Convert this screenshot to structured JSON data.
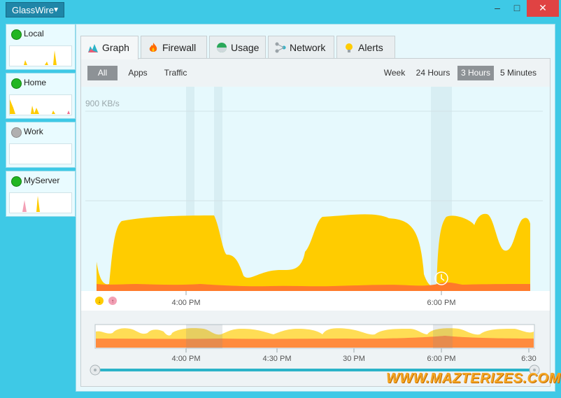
{
  "app": {
    "title": "GlassWire"
  },
  "window_controls": {
    "minimize": "–",
    "maximize": "□",
    "close": "✕"
  },
  "networks": [
    {
      "name": "Local",
      "status": "connected"
    },
    {
      "name": "Home",
      "status": "connected"
    },
    {
      "name": "Work",
      "status": "disconnected"
    },
    {
      "name": "MyServer",
      "status": "connected"
    }
  ],
  "tabs": [
    {
      "label": "Graph",
      "icon": "graph-icon"
    },
    {
      "label": "Firewall",
      "icon": "flame-icon"
    },
    {
      "label": "Usage",
      "icon": "pie-icon"
    },
    {
      "label": "Network",
      "icon": "network-icon"
    },
    {
      "label": "Alerts",
      "icon": "bulb-icon"
    }
  ],
  "filters": {
    "all": "All",
    "apps": "Apps",
    "traffic": "Traffic"
  },
  "ranges": {
    "week": "Week",
    "h24": "24 Hours",
    "h3": "3 Hours",
    "m5": "5 Minutes",
    "selected": "3 Hours"
  },
  "graph": {
    "scale_label": "900 KB/s",
    "legend_download": "↓",
    "legend_upload": "↑"
  },
  "main_axis": [
    "4:00 PM",
    "6:00 PM"
  ],
  "timeline_axis": [
    "4:00 PM",
    "4:30 PM",
    "30 PM",
    "6:00 PM",
    "6:30"
  ],
  "watermark": "WWW.MAZTERIZES.COM",
  "colors": {
    "download": "#ffcc00",
    "upload": "#ff7a2a",
    "accent": "#3ec9e6"
  }
}
